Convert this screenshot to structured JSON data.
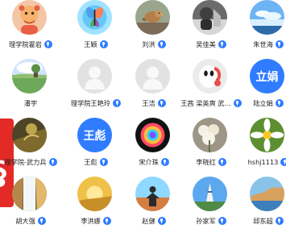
{
  "colors": {
    "accent": "#2f7cff",
    "red_tag": "#e32a27",
    "avatar_text_blue": "#2f7cff"
  },
  "side_tag": {
    "text": "§"
  },
  "contacts": [
    {
      "name": "理学院霍岩",
      "avatar_icon": "cartoon-avatar-icon"
    },
    {
      "name": "王颖",
      "avatar_icon": "butterfly-avatar-icon"
    },
    {
      "name": "刘洪",
      "avatar_icon": "bird-avatar-icon"
    },
    {
      "name": "吴佳美",
      "avatar_icon": "dark-portrait-avatar-icon"
    },
    {
      "name": "朱世海",
      "avatar_icon": "sky-avatar-icon"
    },
    {
      "name": "潘宇",
      "avatar_icon": "field-avatar-icon"
    },
    {
      "name": "理学院王艳玲",
      "avatar_icon": "default-user-avatar-icon"
    },
    {
      "name": "王洁",
      "avatar_icon": "default-user-avatar-icon"
    },
    {
      "name": "王茜 梁英爽 武…",
      "avatar_icon": "robot-avatar-icon"
    },
    {
      "name": "陆立娟",
      "avatar_icon": "text-avatar-icon",
      "avatar_text": "立娟"
    },
    {
      "name": "理学院-武力兵",
      "avatar_icon": "nature-avatar-icon"
    },
    {
      "name": "王彪",
      "avatar_icon": "text-avatar-icon",
      "avatar_text": "王彪"
    },
    {
      "name": "宋介珠",
      "avatar_icon": "rose-avatar-icon"
    },
    {
      "name": "李晓红",
      "avatar_icon": "flower-avatar-icon"
    },
    {
      "name": "hshj1113",
      "avatar_icon": "daisy-avatar-icon"
    },
    {
      "name": "胡大强",
      "avatar_icon": "waterfall-avatar-icon"
    },
    {
      "name": "李洪娜",
      "avatar_icon": "golden-avatar-icon"
    },
    {
      "name": "赵健",
      "avatar_icon": "silhouette-avatar-icon"
    },
    {
      "name": "孙家军",
      "avatar_icon": "tower-avatar-icon"
    },
    {
      "name": "邱东超",
      "avatar_icon": "landscape-avatar-icon"
    }
  ]
}
